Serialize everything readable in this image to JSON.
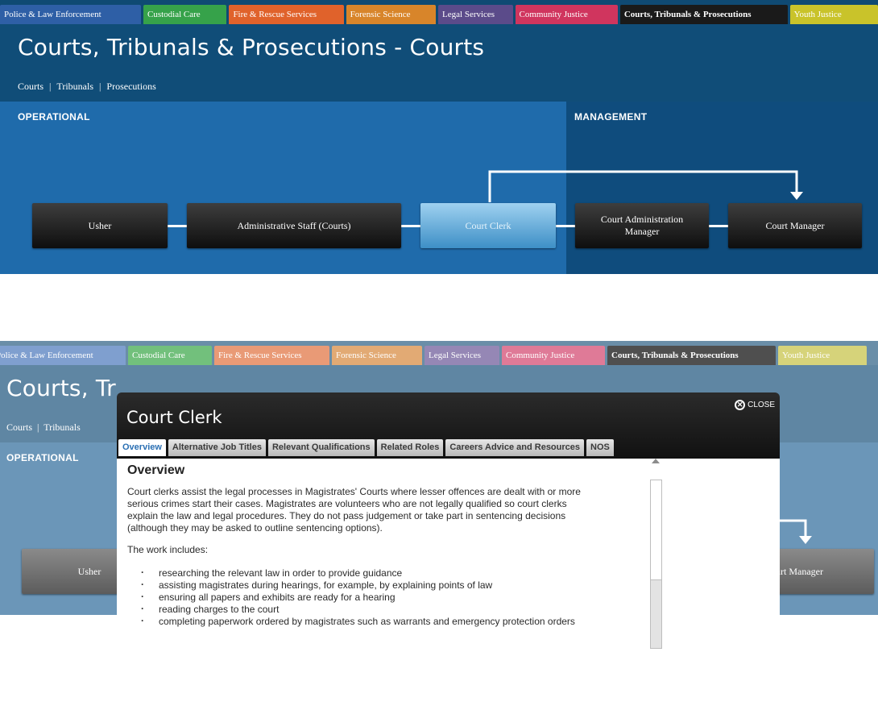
{
  "nav_tabs": [
    {
      "label": "Police & Law Enforcement",
      "color": "#2e5fa6"
    },
    {
      "label": "Custodial Care",
      "color": "#36a24a"
    },
    {
      "label": "Fire & Rescue Services",
      "color": "#e0622b"
    },
    {
      "label": "Forensic Science",
      "color": "#d8852a"
    },
    {
      "label": "Legal Services",
      "color": "#5b4b8a"
    },
    {
      "label": "Community Justice",
      "color": "#d0355e"
    },
    {
      "label": "Courts, Tribunals & Prosecutions",
      "color": "#1a1a1a",
      "active": true
    },
    {
      "label": "Youth Justice",
      "color": "#c9c32a"
    }
  ],
  "page_title": "Courts, Tribunals & Prosecutions - Courts",
  "subnav": [
    "Courts",
    "Tribunals",
    "Prosecutions"
  ],
  "subnav_separator": "|",
  "sections": {
    "operational": "OPERATIONAL",
    "management": "MANAGEMENT"
  },
  "roles": {
    "usher": "Usher",
    "admin_staff": "Administrative Staff (Courts)",
    "court_clerk": "Court Clerk",
    "court_admin_manager": "Court Administration Manager",
    "court_manager": "Court Manager"
  },
  "bottom_fragments": {
    "title_visible": "Courts, Tr",
    "subnav_visible": "Courts  |  Tribunals",
    "court_manager_visible": "urt Manager"
  },
  "modal": {
    "title": "Court Clerk",
    "close_label": "CLOSE",
    "tabs": [
      {
        "label": "Overview",
        "active": true
      },
      {
        "label": "Alternative Job Titles"
      },
      {
        "label": "Relevant Qualifications"
      },
      {
        "label": "Related Roles"
      },
      {
        "label": "Careers Advice and Resources"
      },
      {
        "label": "NOS"
      }
    ],
    "heading": "Overview",
    "paragraph1": "Court clerks assist the legal processes in Magistrates' Courts where lesser offences are dealt with or more serious crimes start their cases. Magistrates are volunteers who are not legally qualified so court clerks explain the law and legal procedures. They do not pass judgement or take part in sentencing decisions (although they may be asked to outline sentencing options).",
    "paragraph2": "The work includes:",
    "bullets": [
      "researching the relevant law in order to provide guidance",
      "assisting magistrates during hearings, for example, by explaining points of law",
      "ensuring all papers and exhibits are ready for a hearing",
      "reading charges to the court",
      "completing paperwork ordered by magistrates such as warrants and emergency protection orders"
    ]
  },
  "colors": {
    "header_blue": "#104d78",
    "operational_blue": "#1f6bab",
    "management_blue": "#0f4c7d",
    "selected_role": "#5aa9dc",
    "dimmed_overlay": "#6b96b8"
  }
}
